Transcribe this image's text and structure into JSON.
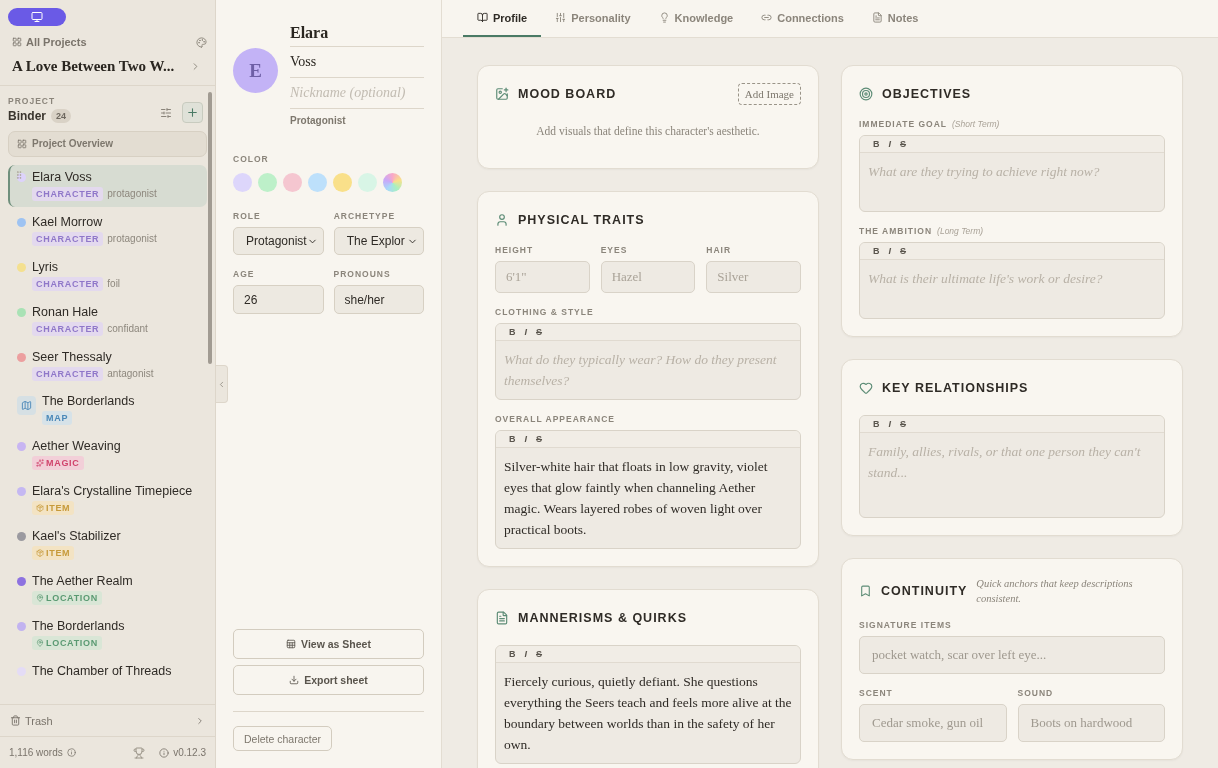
{
  "sidebar": {
    "all_projects": "All Projects",
    "project_title": "A Love Between Two W...",
    "section_label": "PROJECT",
    "binder": "Binder",
    "count": "24",
    "overview": "Project Overview",
    "items": [
      {
        "kind": "character",
        "name": "Elara Voss",
        "color": "#ddd3fb",
        "tag": "CHARACTER",
        "role": "protagonist",
        "selected": true
      },
      {
        "kind": "character",
        "name": "Kael Morrow",
        "color": "#9ec3f2",
        "tag": "CHARACTER",
        "role": "protagonist",
        "selected": false
      },
      {
        "kind": "character",
        "name": "Lyris",
        "color": "#f4e08f",
        "tag": "CHARACTER",
        "role": "foil",
        "selected": false
      },
      {
        "kind": "character",
        "name": "Ronan Hale",
        "color": "#a9e2b5",
        "tag": "CHARACTER",
        "role": "confidant",
        "selected": false
      },
      {
        "kind": "character",
        "name": "Seer Thessaly",
        "color": "#ec9f9f",
        "tag": "CHARACTER",
        "role": "antagonist",
        "selected": false
      },
      {
        "kind": "map",
        "name": "The Borderlands",
        "tag": "MAP",
        "selected": false
      },
      {
        "kind": "magic",
        "name": "Aether Weaving",
        "color": "#c8b5f2",
        "tag": "MAGIC",
        "selected": false
      },
      {
        "kind": "item",
        "name": "Elara's Crystalline Timepiece",
        "color": "#c5b8f2",
        "tag": "ITEM",
        "selected": false
      },
      {
        "kind": "item",
        "name": "Kael's Stabilizer",
        "color": "#9b9aa0",
        "tag": "ITEM",
        "selected": false
      },
      {
        "kind": "location",
        "name": "The Aether Realm",
        "color": "#8d72e0",
        "tag": "LOCATION",
        "selected": false
      },
      {
        "kind": "location",
        "name": "The Borderlands",
        "color": "#c2b3f0",
        "tag": "LOCATION",
        "selected": false
      },
      {
        "kind": "other",
        "name": "The Chamber of Threads",
        "color": "#e4dcf6",
        "selected": false
      }
    ],
    "trash": "Trash",
    "words": "1,116 words",
    "version": "v0.12.3"
  },
  "character": {
    "avatar_letter": "E",
    "first_name": "Elara",
    "last_name": "Voss",
    "nickname_placeholder": "Nickname (optional)",
    "role_caption": "Protagonist",
    "color_label": "COLOR",
    "colors": [
      {
        "kind": "solid",
        "color": "#ddd6fb"
      },
      {
        "kind": "solid",
        "color": "#bdf0c9"
      },
      {
        "kind": "solid",
        "color": "#f5c6d0"
      },
      {
        "kind": "solid",
        "color": "#bde0fb"
      },
      {
        "kind": "solid",
        "color": "#f9e08a"
      },
      {
        "kind": "solid",
        "color": "#d8f5e6"
      },
      {
        "kind": "spectrum"
      }
    ],
    "selects": [
      {
        "label": "ROLE",
        "value": "Protagonist"
      },
      {
        "label": "ARCHETYPE",
        "value": "The Explor"
      }
    ],
    "inputs": [
      {
        "label": "AGE",
        "value": "26"
      },
      {
        "label": "PRONOUNS",
        "value": "she/her"
      }
    ],
    "actions": [
      "View as Sheet",
      "Export sheet"
    ],
    "delete": "Delete character"
  },
  "tabs": [
    {
      "label": "Profile",
      "selected": true
    },
    {
      "label": "Personality",
      "selected": false
    },
    {
      "label": "Knowledge",
      "selected": false
    },
    {
      "label": "Connections",
      "selected": false
    },
    {
      "label": "Notes",
      "selected": false
    }
  ],
  "columns": [
    {
      "cards": [
        {
          "kind": "mood_board",
          "title": "MOOD BOARD",
          "action": "Add Image",
          "blocks": [
            {
              "kind": "note",
              "text": "Add visuals that define this character's aesthetic."
            }
          ]
        },
        {
          "kind": "physical",
          "title": "PHYSICAL TRAITS",
          "blocks": [
            {
              "kind": "inputs",
              "fields": [
                {
                  "label": "HEIGHT",
                  "placeholder": "6'1\""
                },
                {
                  "label": "EYES",
                  "placeholder": "Hazel"
                },
                {
                  "label": "HAIR",
                  "placeholder": "Silver"
                }
              ]
            },
            {
              "kind": "editor",
              "label": "CLOTHING & STYLE",
              "tools": [
                "B",
                "I",
                "S"
              ],
              "placeholder": "What do they typically wear? How do they present themselves?"
            },
            {
              "kind": "editor",
              "label": "OVERALL APPEARANCE",
              "tools": [
                "B",
                "I",
                "S"
              ],
              "value": "Silver-white hair that floats in low gravity, violet eyes that glow faintly when channeling Aether magic. Wears layered robes of woven light over practical boots."
            }
          ]
        },
        {
          "kind": "mannerisms",
          "title": "MANNERISMS & QUIRKS",
          "blocks": [
            {
              "kind": "editor",
              "tools": [
                "B",
                "I",
                "S"
              ],
              "value": "Fiercely curious, quietly defiant. She questions everything the Seers teach and feels more alive at the boundary between worlds than in the safety of her own."
            }
          ]
        }
      ]
    },
    {
      "cards": [
        {
          "kind": "objectives",
          "title": "OBJECTIVES",
          "blocks": [
            {
              "kind": "editor",
              "label": "IMMEDIATE GOAL",
              "hint": "(Short Term)",
              "tools": [
                "B",
                "I",
                "S"
              ],
              "placeholder": "What are they trying to achieve right now?"
            },
            {
              "kind": "editor",
              "label": "THE AMBITION",
              "hint": "(Long Term)",
              "tools": [
                "B",
                "I",
                "S"
              ],
              "placeholder": "What is their ultimate life's work or desire?"
            }
          ]
        },
        {
          "kind": "relationships",
          "title": "KEY RELATIONSHIPS",
          "blocks": [
            {
              "kind": "editor",
              "tools": [
                "B",
                "I",
                "S"
              ],
              "placeholder": "Family, allies, rivals, or that one person they can't stand..."
            }
          ]
        },
        {
          "kind": "continuity",
          "title": "CONTINUITY",
          "subtitle": "Quick anchors that keep descriptions consistent.",
          "blocks": [
            {
              "kind": "inputs",
              "fields": [
                {
                  "label": "SIGNATURE ITEMS",
                  "placeholder": "pocket watch, scar over left eye..."
                }
              ]
            },
            {
              "kind": "inputs",
              "fields": [
                {
                  "label": "SCENT",
                  "placeholder": "Cedar smoke, gun oil"
                },
                {
                  "label": "SOUND",
                  "placeholder": "Boots on hardwood"
                }
              ]
            }
          ]
        }
      ]
    }
  ]
}
